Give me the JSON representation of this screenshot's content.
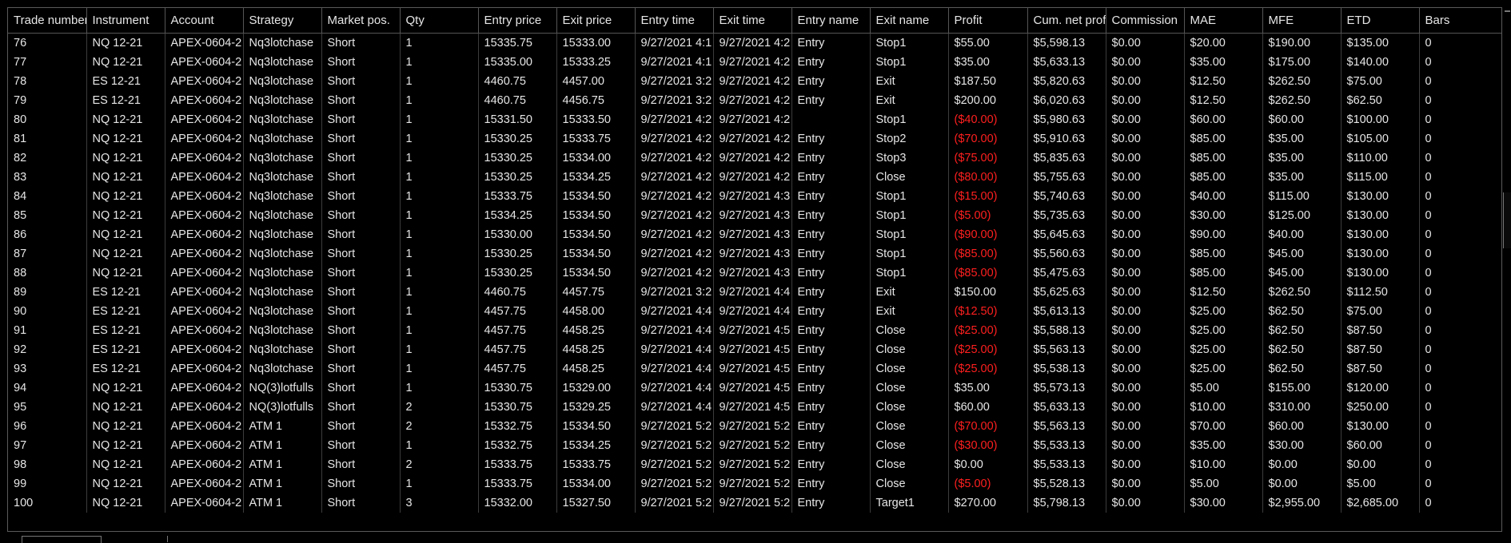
{
  "columns": [
    "Trade number",
    "Instrument",
    "Account",
    "Strategy",
    "Market pos.",
    "Qty",
    "Entry price",
    "Exit price",
    "Entry time",
    "Exit time",
    "Entry name",
    "Exit name",
    "Profit",
    "Cum. net profit",
    "Commission",
    "MAE",
    "MFE",
    "ETD",
    "Bars"
  ],
  "colors": {
    "background": "#000000",
    "text": "#e6e6e6",
    "negative": "#ff1f1f",
    "grid_line": "#555555"
  },
  "rows": [
    [
      "76",
      "NQ 12-21",
      "APEX-0604-2",
      "Nq3lotchase",
      "Short",
      "1",
      "15335.75",
      "15333.00",
      "9/27/2021 4:1",
      "9/27/2021 4:2",
      "Entry",
      "Stop1",
      "$55.00",
      "$5,598.13",
      "$0.00",
      "$20.00",
      "$190.00",
      "$135.00",
      "0"
    ],
    [
      "77",
      "NQ 12-21",
      "APEX-0604-2",
      "Nq3lotchase",
      "Short",
      "1",
      "15335.00",
      "15333.25",
      "9/27/2021 4:1",
      "9/27/2021 4:2",
      "Entry",
      "Stop1",
      "$35.00",
      "$5,633.13",
      "$0.00",
      "$35.00",
      "$175.00",
      "$140.00",
      "0"
    ],
    [
      "78",
      "ES 12-21",
      "APEX-0604-2",
      "Nq3lotchase",
      "Short",
      "1",
      "4460.75",
      "4457.00",
      "9/27/2021 3:2",
      "9/27/2021 4:2",
      "Entry",
      "Exit",
      "$187.50",
      "$5,820.63",
      "$0.00",
      "$12.50",
      "$262.50",
      "$75.00",
      "0"
    ],
    [
      "79",
      "ES 12-21",
      "APEX-0604-2",
      "Nq3lotchase",
      "Short",
      "1",
      "4460.75",
      "4456.75",
      "9/27/2021 3:2",
      "9/27/2021 4:2",
      "Entry",
      "Exit",
      "$200.00",
      "$6,020.63",
      "$0.00",
      "$12.50",
      "$262.50",
      "$62.50",
      "0"
    ],
    [
      "80",
      "NQ 12-21",
      "APEX-0604-2",
      "Nq3lotchase",
      "Short",
      "1",
      "15331.50",
      "15333.50",
      "9/27/2021 4:2",
      "9/27/2021 4:2",
      "",
      "Stop1",
      "($40.00)",
      "$5,980.63",
      "$0.00",
      "$60.00",
      "$60.00",
      "$100.00",
      "0"
    ],
    [
      "81",
      "NQ 12-21",
      "APEX-0604-2",
      "Nq3lotchase",
      "Short",
      "1",
      "15330.25",
      "15333.75",
      "9/27/2021 4:2",
      "9/27/2021 4:2",
      "Entry",
      "Stop2",
      "($70.00)",
      "$5,910.63",
      "$0.00",
      "$85.00",
      "$35.00",
      "$105.00",
      "0"
    ],
    [
      "82",
      "NQ 12-21",
      "APEX-0604-2",
      "Nq3lotchase",
      "Short",
      "1",
      "15330.25",
      "15334.00",
      "9/27/2021 4:2",
      "9/27/2021 4:2",
      "Entry",
      "Stop3",
      "($75.00)",
      "$5,835.63",
      "$0.00",
      "$85.00",
      "$35.00",
      "$110.00",
      "0"
    ],
    [
      "83",
      "NQ 12-21",
      "APEX-0604-2",
      "Nq3lotchase",
      "Short",
      "1",
      "15330.25",
      "15334.25",
      "9/27/2021 4:2",
      "9/27/2021 4:2",
      "Entry",
      "Close",
      "($80.00)",
      "$5,755.63",
      "$0.00",
      "$85.00",
      "$35.00",
      "$115.00",
      "0"
    ],
    [
      "84",
      "NQ 12-21",
      "APEX-0604-2",
      "Nq3lotchase",
      "Short",
      "1",
      "15333.75",
      "15334.50",
      "9/27/2021 4:2",
      "9/27/2021 4:3",
      "Entry",
      "Stop1",
      "($15.00)",
      "$5,740.63",
      "$0.00",
      "$40.00",
      "$115.00",
      "$130.00",
      "0"
    ],
    [
      "85",
      "NQ 12-21",
      "APEX-0604-2",
      "Nq3lotchase",
      "Short",
      "1",
      "15334.25",
      "15334.50",
      "9/27/2021 4:2",
      "9/27/2021 4:3",
      "Entry",
      "Stop1",
      "($5.00)",
      "$5,735.63",
      "$0.00",
      "$30.00",
      "$125.00",
      "$130.00",
      "0"
    ],
    [
      "86",
      "NQ 12-21",
      "APEX-0604-2",
      "Nq3lotchase",
      "Short",
      "1",
      "15330.00",
      "15334.50",
      "9/27/2021 4:2",
      "9/27/2021 4:3",
      "Entry",
      "Stop1",
      "($90.00)",
      "$5,645.63",
      "$0.00",
      "$90.00",
      "$40.00",
      "$130.00",
      "0"
    ],
    [
      "87",
      "NQ 12-21",
      "APEX-0604-2",
      "Nq3lotchase",
      "Short",
      "1",
      "15330.25",
      "15334.50",
      "9/27/2021 4:2",
      "9/27/2021 4:3",
      "Entry",
      "Stop1",
      "($85.00)",
      "$5,560.63",
      "$0.00",
      "$85.00",
      "$45.00",
      "$130.00",
      "0"
    ],
    [
      "88",
      "NQ 12-21",
      "APEX-0604-2",
      "Nq3lotchase",
      "Short",
      "1",
      "15330.25",
      "15334.50",
      "9/27/2021 4:2",
      "9/27/2021 4:3",
      "Entry",
      "Stop1",
      "($85.00)",
      "$5,475.63",
      "$0.00",
      "$85.00",
      "$45.00",
      "$130.00",
      "0"
    ],
    [
      "89",
      "ES 12-21",
      "APEX-0604-2",
      "Nq3lotchase",
      "Short",
      "1",
      "4460.75",
      "4457.75",
      "9/27/2021 3:2",
      "9/27/2021 4:4",
      "Entry",
      "Exit",
      "$150.00",
      "$5,625.63",
      "$0.00",
      "$12.50",
      "$262.50",
      "$112.50",
      "0"
    ],
    [
      "90",
      "ES 12-21",
      "APEX-0604-2",
      "Nq3lotchase",
      "Short",
      "1",
      "4457.75",
      "4458.00",
      "9/27/2021 4:4",
      "9/27/2021 4:4",
      "Entry",
      "Exit",
      "($12.50)",
      "$5,613.13",
      "$0.00",
      "$25.00",
      "$62.50",
      "$75.00",
      "0"
    ],
    [
      "91",
      "ES 12-21",
      "APEX-0604-2",
      "Nq3lotchase",
      "Short",
      "1",
      "4457.75",
      "4458.25",
      "9/27/2021 4:4",
      "9/27/2021 4:5",
      "Entry",
      "Close",
      "($25.00)",
      "$5,588.13",
      "$0.00",
      "$25.00",
      "$62.50",
      "$87.50",
      "0"
    ],
    [
      "92",
      "ES 12-21",
      "APEX-0604-2",
      "Nq3lotchase",
      "Short",
      "1",
      "4457.75",
      "4458.25",
      "9/27/2021 4:4",
      "9/27/2021 4:5",
      "Entry",
      "Close",
      "($25.00)",
      "$5,563.13",
      "$0.00",
      "$25.00",
      "$62.50",
      "$87.50",
      "0"
    ],
    [
      "93",
      "ES 12-21",
      "APEX-0604-2",
      "Nq3lotchase",
      "Short",
      "1",
      "4457.75",
      "4458.25",
      "9/27/2021 4:4",
      "9/27/2021 4:5",
      "Entry",
      "Close",
      "($25.00)",
      "$5,538.13",
      "$0.00",
      "$25.00",
      "$62.50",
      "$87.50",
      "0"
    ],
    [
      "94",
      "NQ 12-21",
      "APEX-0604-2",
      "NQ(3)lotfulls",
      "Short",
      "1",
      "15330.75",
      "15329.00",
      "9/27/2021 4:4",
      "9/27/2021 4:5",
      "Entry",
      "Close",
      "$35.00",
      "$5,573.13",
      "$0.00",
      "$5.00",
      "$155.00",
      "$120.00",
      "0"
    ],
    [
      "95",
      "NQ 12-21",
      "APEX-0604-2",
      "NQ(3)lotfulls",
      "Short",
      "2",
      "15330.75",
      "15329.25",
      "9/27/2021 4:4",
      "9/27/2021 4:5",
      "Entry",
      "Close",
      "$60.00",
      "$5,633.13",
      "$0.00",
      "$10.00",
      "$310.00",
      "$250.00",
      "0"
    ],
    [
      "96",
      "NQ 12-21",
      "APEX-0604-2",
      "ATM 1",
      "Short",
      "2",
      "15332.75",
      "15334.50",
      "9/27/2021 5:2",
      "9/27/2021 5:2",
      "Entry",
      "Close",
      "($70.00)",
      "$5,563.13",
      "$0.00",
      "$70.00",
      "$60.00",
      "$130.00",
      "0"
    ],
    [
      "97",
      "NQ 12-21",
      "APEX-0604-2",
      "ATM 1",
      "Short",
      "1",
      "15332.75",
      "15334.25",
      "9/27/2021 5:2",
      "9/27/2021 5:2",
      "Entry",
      "Close",
      "($30.00)",
      "$5,533.13",
      "$0.00",
      "$35.00",
      "$30.00",
      "$60.00",
      "0"
    ],
    [
      "98",
      "NQ 12-21",
      "APEX-0604-2",
      "ATM 1",
      "Short",
      "2",
      "15333.75",
      "15333.75",
      "9/27/2021 5:2",
      "9/27/2021 5:2",
      "Entry",
      "Close",
      "$0.00",
      "$5,533.13",
      "$0.00",
      "$10.00",
      "$0.00",
      "$0.00",
      "0"
    ],
    [
      "99",
      "NQ 12-21",
      "APEX-0604-2",
      "ATM 1",
      "Short",
      "1",
      "15333.75",
      "15334.00",
      "9/27/2021 5:2",
      "9/27/2021 5:2",
      "Entry",
      "Close",
      "($5.00)",
      "$5,528.13",
      "$0.00",
      "$5.00",
      "$0.00",
      "$5.00",
      "0"
    ],
    [
      "100",
      "NQ 12-21",
      "APEX-0604-2",
      "ATM 1",
      "Short",
      "3",
      "15332.00",
      "15327.50",
      "9/27/2021 5:2",
      "9/27/2021 5:2",
      "Entry",
      "Target1",
      "$270.00",
      "$5,798.13",
      "$0.00",
      "$30.00",
      "$2,955.00",
      "$2,685.00",
      "0"
    ]
  ]
}
